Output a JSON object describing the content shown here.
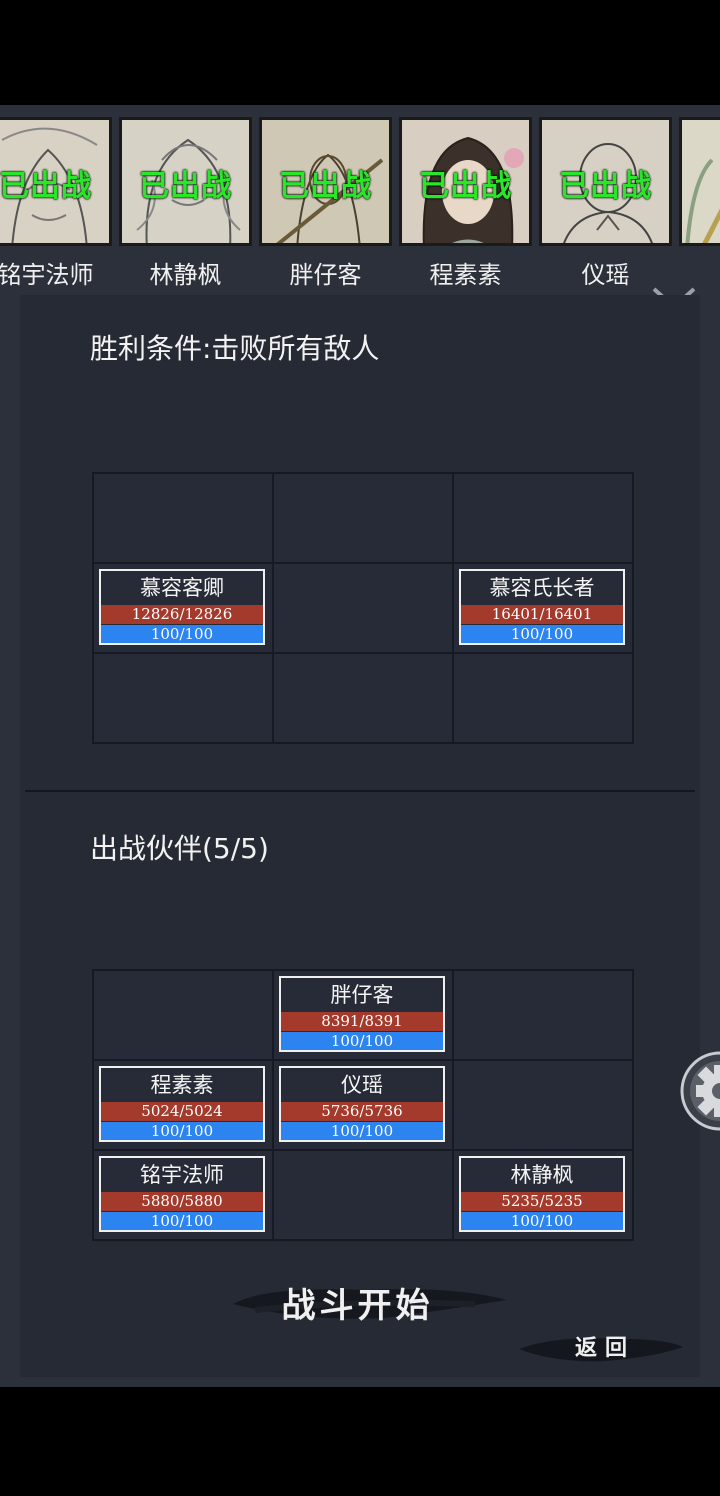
{
  "roster": [
    {
      "name": "铭宇法师",
      "status": "已出战"
    },
    {
      "name": "林静枫",
      "status": "已出战"
    },
    {
      "name": "胖仔客",
      "status": "已出战"
    },
    {
      "name": "程素素",
      "status": "已出战"
    },
    {
      "name": "仪瑶",
      "status": "已出战"
    }
  ],
  "enemy_section": {
    "title": "胜利条件:击败所有敌人",
    "units": [
      {
        "name": "慕容客卿",
        "hp": "12826/12826",
        "mp": "100/100"
      },
      {
        "name": "慕容氏长者",
        "hp": "16401/16401",
        "mp": "100/100"
      }
    ]
  },
  "ally_section": {
    "title": "出战伙伴(5/5)",
    "units": [
      {
        "name": "胖仔客",
        "hp": "8391/8391",
        "mp": "100/100"
      },
      {
        "name": "程素素",
        "hp": "5024/5024",
        "mp": "100/100"
      },
      {
        "name": "仪瑶",
        "hp": "5736/5736",
        "mp": "100/100"
      },
      {
        "name": "铭宇法师",
        "hp": "5880/5880",
        "mp": "100/100"
      },
      {
        "name": "林静枫",
        "hp": "5235/5235",
        "mp": "100/100"
      }
    ]
  },
  "buttons": {
    "start": "战斗开始",
    "back": "返回"
  },
  "colors": {
    "deployed_text": "#29e629",
    "hp_bar": "#a33a2c",
    "mp_bar": "#2b84f0",
    "panel_bg": "#252a35"
  },
  "icons": [
    "collapse-chevron-icon",
    "settings-gear-icon"
  ]
}
